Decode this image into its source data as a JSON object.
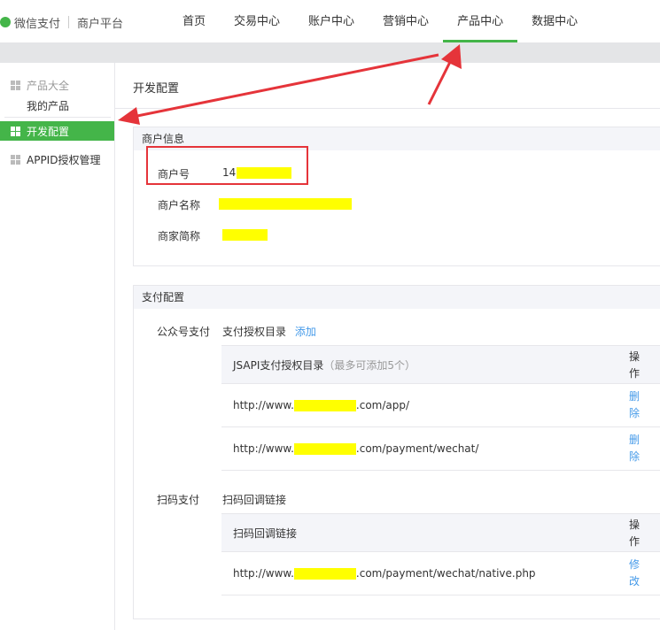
{
  "header": {
    "brand": "微信支付",
    "platform": "商户平台",
    "nav": [
      "首页",
      "交易中心",
      "账户中心",
      "营销中心",
      "产品中心",
      "数据中心"
    ],
    "active_nav_index": 4
  },
  "sidebar": {
    "group_title": "产品大全",
    "my_products": "我的产品",
    "active_item": "开发配置",
    "item_appid": "APPID授权管理"
  },
  "main": {
    "page_title": "开发配置",
    "merchant_info": {
      "header": "商户信息",
      "merchant_id_label": "商户号",
      "merchant_id_value_prefix": "14",
      "merchant_name_label": "商户名称",
      "merchant_short_label": "商家简称"
    },
    "pay_config": {
      "header": "支付配置",
      "jsapi": {
        "label": "公众号支付",
        "dir_label": "支付授权目录",
        "add_link": "添加",
        "table_header": "JSAPI支付授权目录",
        "table_header_note": "（最多可添加5个）",
        "op_header": "操作",
        "rows": [
          {
            "prefix": "http://www.",
            "suffix": ".com/app/",
            "action": "删除"
          },
          {
            "prefix": "http://www.",
            "suffix": ".com/payment/wechat/",
            "action": "删除"
          }
        ]
      },
      "native": {
        "label": "扫码支付",
        "callback_label": "扫码回调链接",
        "table_header": "扫码回调链接",
        "op_header": "操作",
        "rows": [
          {
            "prefix": "http://www.",
            "suffix": ".com/payment/wechat/native.php",
            "action": "修改"
          }
        ]
      }
    }
  },
  "colors": {
    "brand_green": "#44b549",
    "link_blue": "#459ae9",
    "annotation_red": "#e5343a",
    "redaction_yellow": "#ffff00"
  }
}
